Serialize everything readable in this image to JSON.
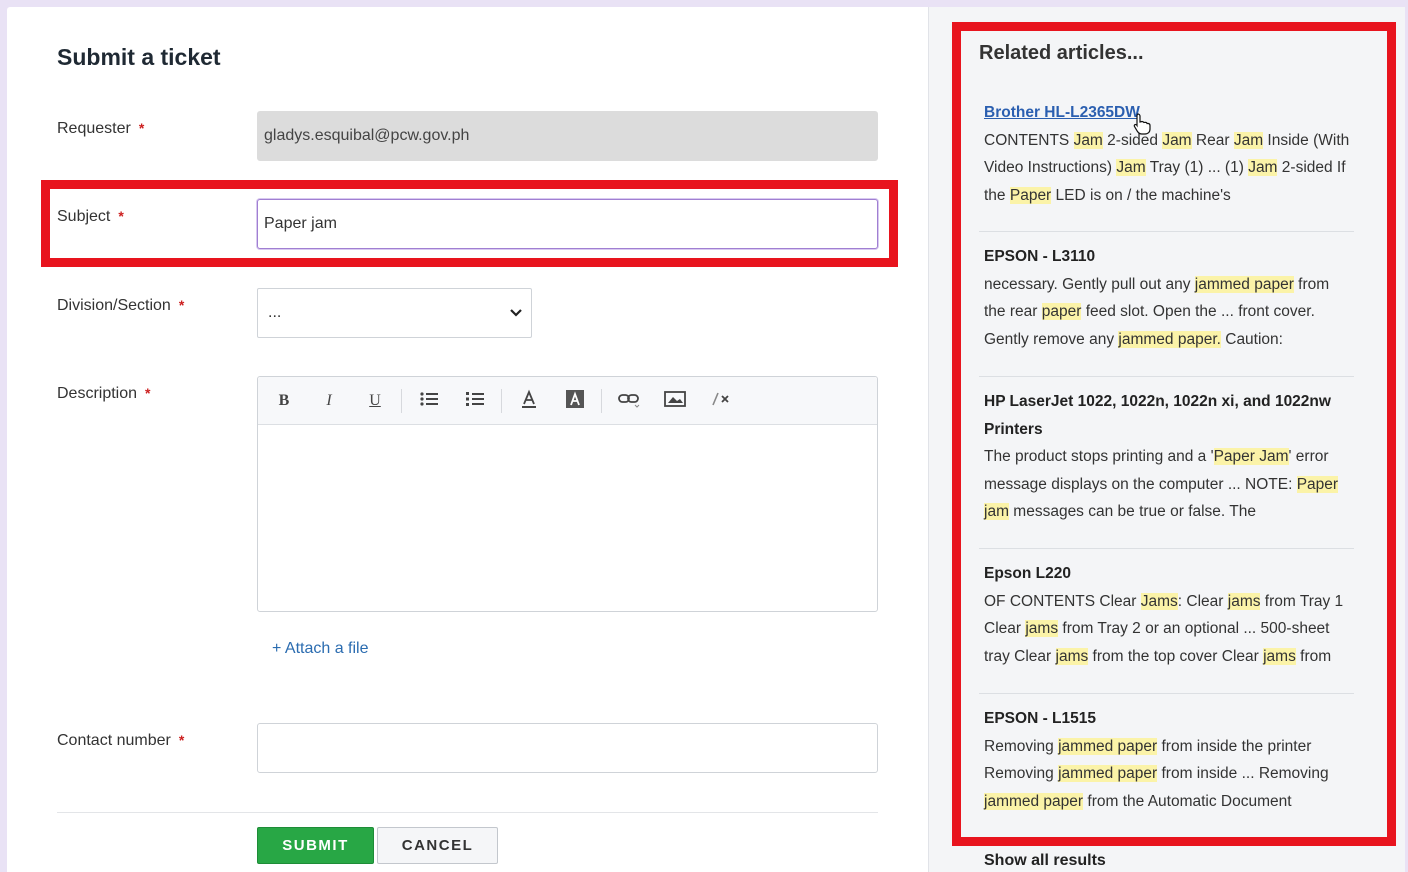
{
  "form": {
    "title": "Submit a ticket",
    "requester_label": "Requester",
    "requester_value": "gladys.esquibal@pcw.gov.ph",
    "subject_label": "Subject",
    "subject_value": "Paper jam",
    "division_label": "Division/Section",
    "division_value": "...",
    "description_label": "Description",
    "contact_label": "Contact number",
    "contact_value": "",
    "required_marker": "*",
    "attach_label": "+ Attach a file",
    "submit_label": "SUBMIT",
    "cancel_label": "CANCEL"
  },
  "toolbar": {
    "bold": "B",
    "italic": "I",
    "underline": "U"
  },
  "related": {
    "title": "Related articles...",
    "show_all": "Show all results",
    "articles": [
      {
        "title": "Brother HL-L2365DW"
      },
      {
        "title": "EPSON - L3110"
      },
      {
        "title": "HP LaserJet 1022, 1022n, 1022n xi, and 1022nw Printers"
      },
      {
        "title": "Epson L220"
      },
      {
        "title": "EPSON - L1515"
      }
    ]
  },
  "colors": {
    "highlight_box": "#e8141e",
    "submit": "#28a745",
    "link": "#2b5fb0",
    "mark": "#fbf3a8"
  }
}
